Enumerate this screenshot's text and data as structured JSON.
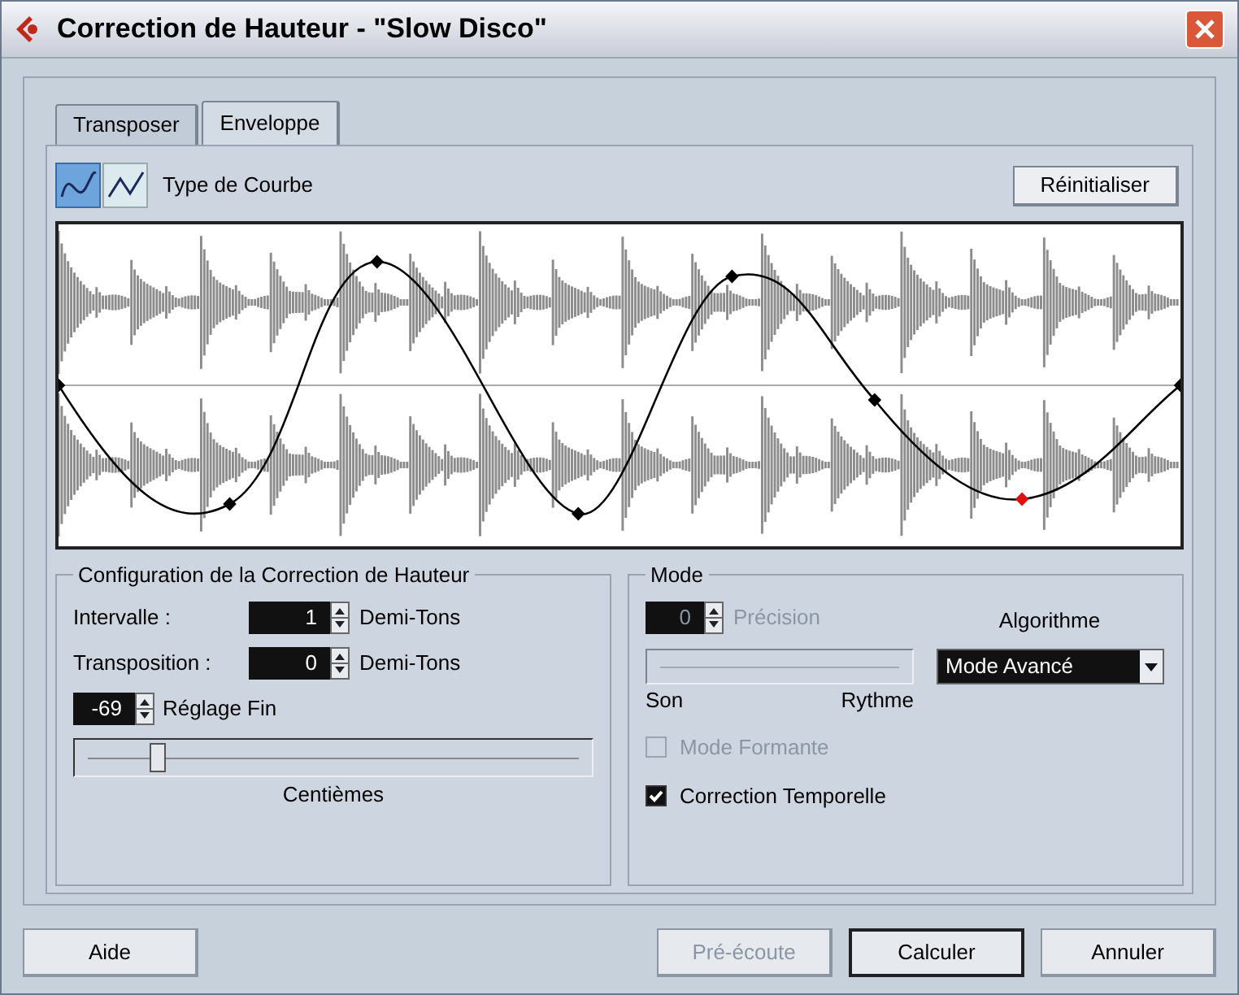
{
  "window": {
    "title": "Correction de Hauteur - \"Slow Disco\""
  },
  "tabs": [
    {
      "label": "Transposer",
      "selected": false
    },
    {
      "label": "Enveloppe",
      "selected": true
    }
  ],
  "curve_types": [
    {
      "kind": "spline",
      "selected": true
    },
    {
      "kind": "linear",
      "selected": false
    }
  ],
  "curve_type_label": "Type de Courbe",
  "reset_button": "Réinitialiser",
  "pitch_group": {
    "title": "Configuration de la Correction de Hauteur",
    "interval": {
      "label": "Intervalle :",
      "value": "1",
      "unit": "Demi-Tons"
    },
    "transposition": {
      "label": "Transposition :",
      "value": "0",
      "unit": "Demi-Tons"
    },
    "fine": {
      "value": "-69",
      "label": "Réglage Fin"
    },
    "fine_slider": {
      "level": 0.16,
      "caption": "Centièmes"
    }
  },
  "mode_group": {
    "title": "Mode",
    "precision": {
      "value": "0",
      "label": "Précision",
      "disabled": true
    },
    "precision_slider": {
      "disabled": true
    },
    "slider_left": "Son",
    "slider_right": "Rythme",
    "algorithm_label": "Algorithme",
    "algorithm_value": "Mode Avancé",
    "checkboxes": [
      {
        "label": "Mode Formante",
        "checked": false,
        "disabled": true
      },
      {
        "label": "Correction Temporelle",
        "checked": true,
        "disabled": false
      }
    ]
  },
  "buttons": [
    {
      "label": "Aide",
      "disabled": false,
      "default": false
    },
    {
      "label": "Pré-écoute",
      "disabled": true,
      "default": false
    },
    {
      "label": "Calculer",
      "disabled": false,
      "default": true
    },
    {
      "label": "Annuler",
      "disabled": false,
      "default": false
    }
  ]
}
